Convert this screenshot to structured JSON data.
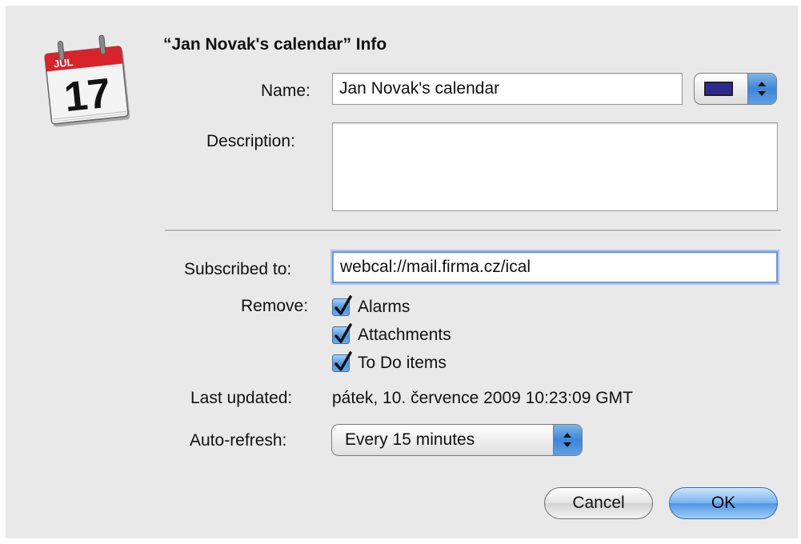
{
  "dialog": {
    "title": "“Jan Novak's calendar” Info",
    "calendar_icon": {
      "icon": "calendar-icon",
      "month": "JUL",
      "day": "17"
    }
  },
  "fields": {
    "name_label": "Name:",
    "name_value": "Jan Novak's calendar",
    "color_swatch": "#2c2a8f",
    "description_label": "Description:",
    "description_value": "",
    "subscribed_label": "Subscribed to:",
    "subscribed_value": "webcal://mail.firma.cz/ical"
  },
  "remove": {
    "label": "Remove:",
    "options": [
      {
        "label": "Alarms",
        "checked": true
      },
      {
        "label": "Attachments",
        "checked": true
      },
      {
        "label": "To Do items",
        "checked": true
      }
    ]
  },
  "last_updated": {
    "label": "Last updated:",
    "value": "pátek, 10. července 2009 10:23:09 GMT"
  },
  "auto_refresh": {
    "label": "Auto-refresh:",
    "value": "Every 15 minutes"
  },
  "buttons": {
    "cancel": "Cancel",
    "ok": "OK"
  },
  "colors": {
    "dialog_bg": "#e9e9e9",
    "accent_blue": "#4f95e0"
  }
}
